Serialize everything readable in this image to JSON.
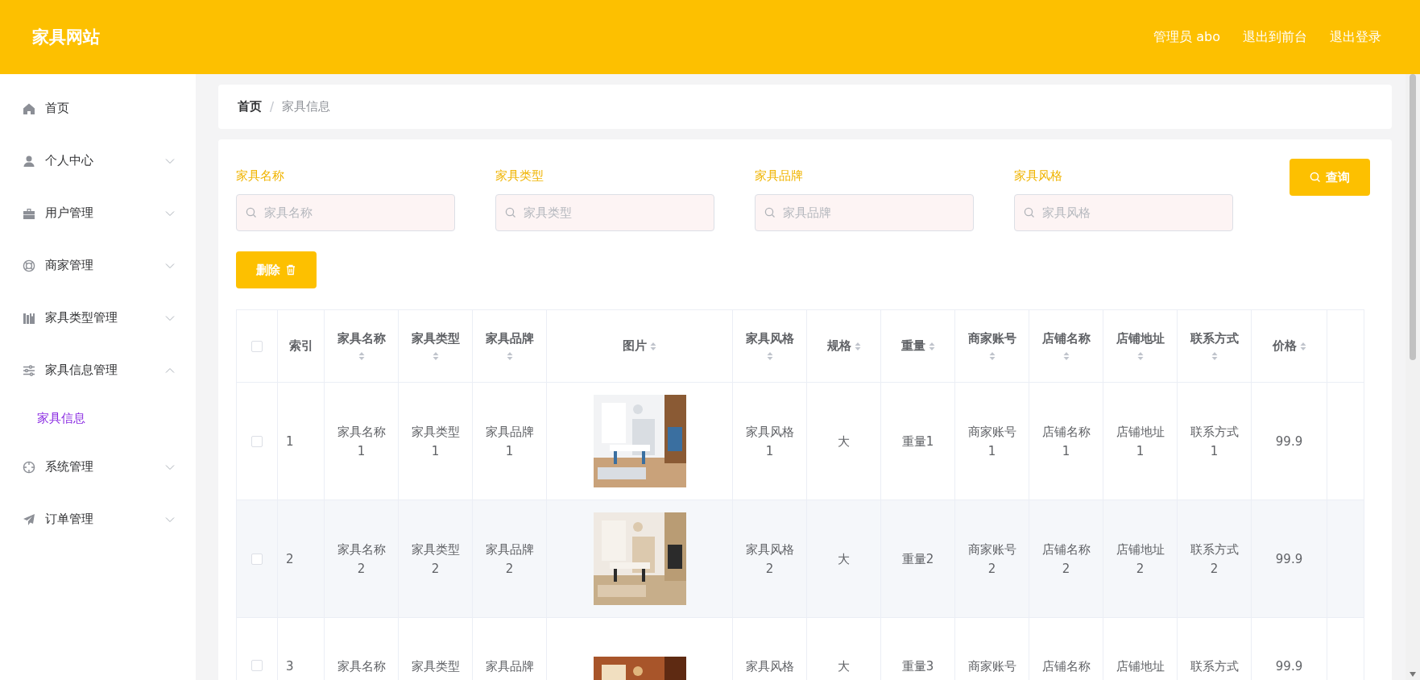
{
  "header": {
    "title": "家具网站",
    "links": [
      "管理员 abo",
      "退出到前台",
      "退出登录"
    ]
  },
  "sidebar": {
    "items": [
      {
        "label": "首页"
      },
      {
        "label": "个人中心",
        "expanded": false
      },
      {
        "label": "用户管理",
        "expanded": false
      },
      {
        "label": "商家管理",
        "expanded": false
      },
      {
        "label": "家具类型管理",
        "expanded": false
      },
      {
        "label": "家具信息管理",
        "expanded": true,
        "children": [
          {
            "label": "家具信息",
            "selected": true
          }
        ]
      },
      {
        "label": "系统管理",
        "expanded": false
      },
      {
        "label": "订单管理",
        "expanded": false
      }
    ]
  },
  "breadcrumb": {
    "items": [
      "首页",
      "家具信息"
    ],
    "separator": "/"
  },
  "search": {
    "fields": [
      {
        "label": "家具名称",
        "placeholder": "家具名称"
      },
      {
        "label": "家具类型",
        "placeholder": "家具类型"
      },
      {
        "label": "家具品牌",
        "placeholder": "家具品牌"
      },
      {
        "label": "家具风格",
        "placeholder": "家具风格"
      }
    ],
    "query_button": "查询"
  },
  "delete_button": "删除",
  "table": {
    "select_all_checked": false,
    "columns": [
      {
        "label": "索引",
        "sortable": false
      },
      {
        "label": "家具名称",
        "sortable": true
      },
      {
        "label": "家具类型",
        "sortable": true
      },
      {
        "label": "家具品牌",
        "sortable": true
      },
      {
        "label": "图片",
        "sortable": true
      },
      {
        "label": "家具风格",
        "sortable": true
      },
      {
        "label": "规格",
        "sortable": true
      },
      {
        "label": "重量",
        "sortable": true
      },
      {
        "label": "商家账号",
        "sortable": true
      },
      {
        "label": "店铺名称",
        "sortable": true
      },
      {
        "label": "店铺地址",
        "sortable": true
      },
      {
        "label": "联系方式",
        "sortable": true
      },
      {
        "label": "价格",
        "sortable": true
      }
    ],
    "rows": [
      {
        "checked": false,
        "cells": [
          "1",
          "家具名称\n1",
          "家具类型\n1",
          "家具品牌\n1",
          {
            "kind": "picture"
          },
          "家具风格\n1",
          "大",
          "重量1",
          "商家账号\n1",
          "店铺名称\n1",
          "店铺地址\n1",
          "联系方式\n1",
          "99.9"
        ]
      },
      {
        "checked": false,
        "cells": [
          "2",
          "家具名称\n2",
          "家具类型\n2",
          "家具品牌\n2",
          {
            "kind": "picture"
          },
          "家具风格\n2",
          "大",
          "重量2",
          "商家账号\n2",
          "店铺名称\n2",
          "店铺地址\n2",
          "联系方式\n2",
          "99.9"
        ]
      },
      {
        "checked": false,
        "cells": [
          "3",
          "家具名称",
          "家具类型",
          "家具品牌",
          {
            "kind": "picture"
          },
          "家具风格",
          "大",
          "重量3",
          "商家账号",
          "店铺名称",
          "店铺地址",
          "联系方式",
          "99.9"
        ]
      }
    ]
  }
}
